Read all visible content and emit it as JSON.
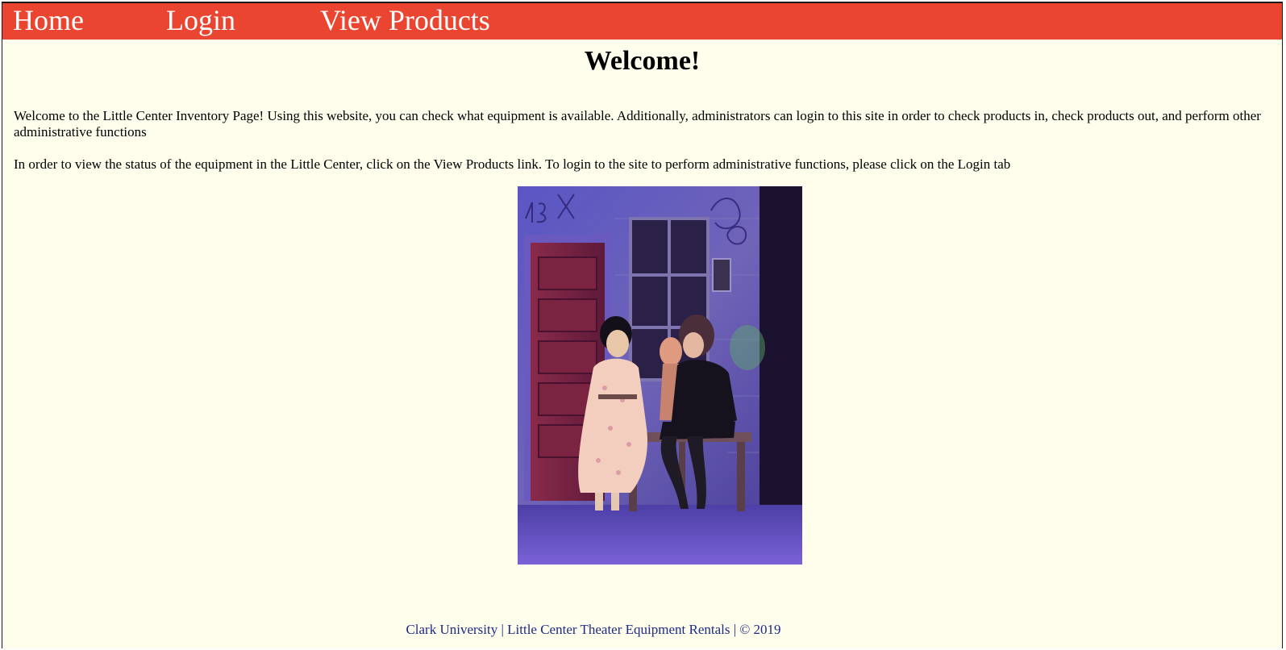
{
  "nav": {
    "home": "Home",
    "login": "Login",
    "view_products": "View Products"
  },
  "main": {
    "title": "Welcome!",
    "paragraph_1": "Welcome to the Little Center Inventory Page! Using this website, you can check what equipment is available. Additionally, administrators can login to this site in order to check products in, check products out, and perform other administrative functions",
    "paragraph_2": "In order to view the status of the equipment in the Little Center, click on the View Products link. To login to the site to perform administrative functions, please click on the Login tab"
  },
  "footer": {
    "text": "Clark University | Little Center Theater Equipment Rentals | © 2019"
  },
  "colors": {
    "nav_background": "#ea4530",
    "page_background": "#fffeec",
    "footer_text": "#1c2a86"
  }
}
